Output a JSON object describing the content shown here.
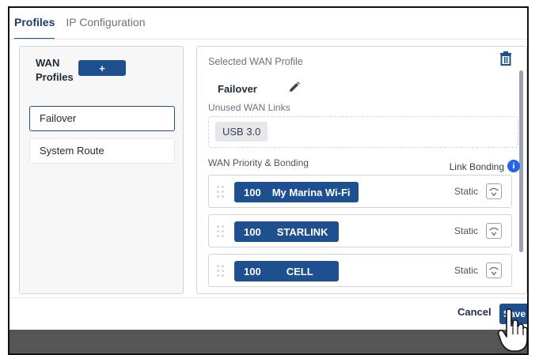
{
  "tabs": [
    {
      "label": "Profiles",
      "active": true
    },
    {
      "label": "IP Configuration",
      "active": false
    }
  ],
  "left_panel": {
    "title": "WAN Profiles",
    "add_label": "+",
    "profiles": [
      {
        "name": "Failover",
        "selected": true
      },
      {
        "name": "System Route",
        "selected": false
      }
    ]
  },
  "right_panel": {
    "selected_label": "Selected WAN Profile",
    "profile_name": "Failover",
    "unused_label": "Unused WAN Links",
    "unused_links": [
      "USB 3.0"
    ],
    "priority_label": "WAN Priority & Bonding",
    "link_bonding_label": "Link Bonding",
    "info_glyph": "i",
    "links": [
      {
        "priority": "100",
        "name": "My Marina Wi-Fi",
        "mode": "Static"
      },
      {
        "priority": "100",
        "name": "STARLINK",
        "mode": "Static"
      },
      {
        "priority": "100",
        "name": "CELL",
        "mode": "Static"
      }
    ]
  },
  "footer": {
    "cancel_label": "Cancel",
    "save_label": "Save"
  },
  "colors": {
    "accent": "#1e4f8f",
    "info": "#2563eb"
  },
  "icons": [
    "trash-icon",
    "pencil-icon",
    "drag-handle-icon",
    "wifi-signal-icon",
    "info-icon",
    "hand-cursor-icon"
  ]
}
